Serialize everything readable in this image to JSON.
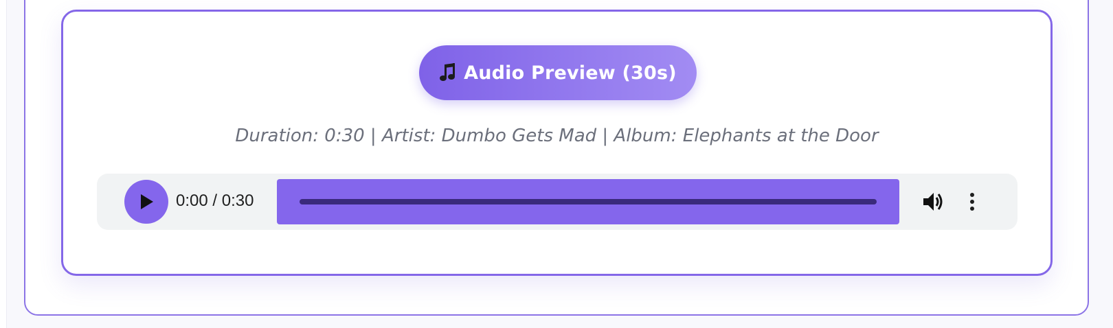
{
  "preview": {
    "badge_label": "Audio Preview (30s)",
    "badge_icon": "music-note-icon",
    "meta": "Duration: 0:30 | Artist: Dumbo Gets Mad | Album: Elephants at the Door"
  },
  "player": {
    "time": "0:00 / 0:30",
    "progress_fraction": 0,
    "icons": [
      "play-icon",
      "volume-icon",
      "more-options-icon"
    ]
  },
  "colors": {
    "accent": "#8466ec",
    "badge_gradient_start": "#7f62e8",
    "badge_gradient_end": "#a28cf3",
    "card_border": "#8467e8",
    "meta_text": "#6b6f7b",
    "player_background": "#f1f3f4"
  }
}
